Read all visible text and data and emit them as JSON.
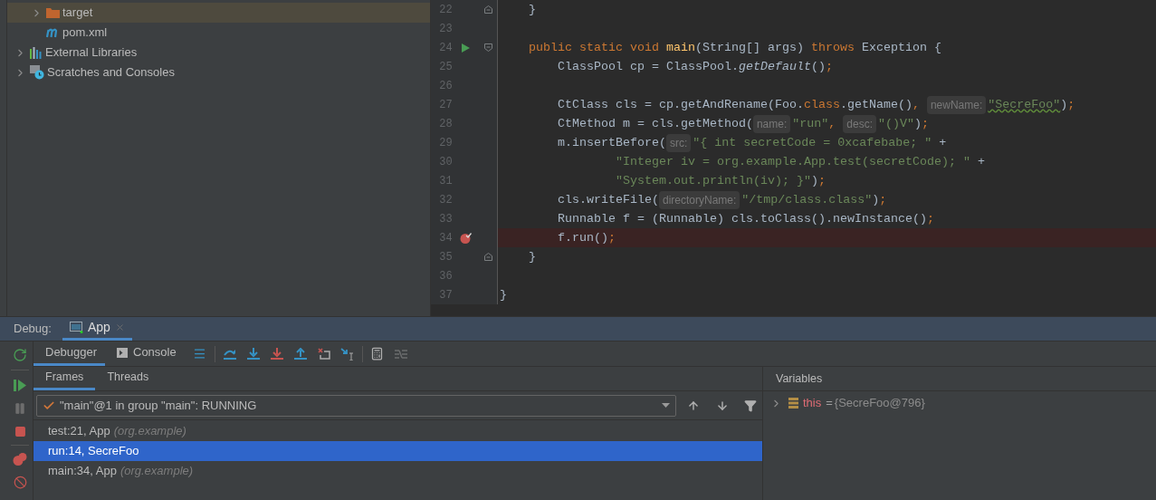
{
  "project_tree": [
    {
      "kind": "folder",
      "label": "target",
      "expanded": false,
      "selected": true
    },
    {
      "kind": "maven-file",
      "label": "pom.xml",
      "selected": false
    },
    {
      "kind": "libraries",
      "label": "External Libraries",
      "expanded": false,
      "selected": false
    },
    {
      "kind": "scratches",
      "label": "Scratches and Consoles",
      "expanded": false,
      "selected": false
    }
  ],
  "editor": {
    "lines": [
      {
        "number": "22",
        "runnable": false,
        "breakpoint": false,
        "fold_start": false,
        "fold_end": true,
        "highlighted": false,
        "tokens": [
          {
            "kind": "plain",
            "text": "    }"
          }
        ]
      },
      {
        "number": "23",
        "runnable": false,
        "breakpoint": false,
        "fold_start": false,
        "fold_end": false,
        "highlighted": false
      },
      {
        "number": "24",
        "runnable": true,
        "breakpoint": false,
        "fold_start": true,
        "fold_end": false,
        "highlighted": false,
        "tokens": [
          {
            "kind": "keyword",
            "text": "    public static void "
          },
          {
            "kind": "declaration",
            "text": "main"
          },
          {
            "kind": "plain",
            "text": "(String[] args) "
          },
          {
            "kind": "keyword",
            "text": "throws"
          },
          {
            "kind": "plain",
            "text": " Exception {"
          }
        ]
      },
      {
        "number": "25",
        "runnable": false,
        "breakpoint": false,
        "fold_start": false,
        "fold_end": false,
        "highlighted": false,
        "tokens": [
          {
            "kind": "plain",
            "text": "        ClassPool cp = ClassPool."
          },
          {
            "kind": "italic",
            "text": "getDefault"
          },
          {
            "kind": "plain",
            "text": "()"
          },
          {
            "kind": "keyword",
            "text": ";"
          }
        ]
      },
      {
        "number": "26",
        "runnable": false,
        "breakpoint": false,
        "fold_start": false,
        "fold_end": false,
        "highlighted": false
      },
      {
        "number": "27",
        "runnable": false,
        "breakpoint": false,
        "fold_start": false,
        "fold_end": false,
        "highlighted": false,
        "tokens": [
          {
            "kind": "plain",
            "text": "        CtClass cls = cp.getAndRename(Foo."
          },
          {
            "kind": "keyword",
            "text": "class"
          },
          {
            "kind": "plain",
            "text": ".getName()"
          },
          {
            "kind": "keyword",
            "text": ", "
          },
          {
            "kind": "hint",
            "text": "newName:"
          },
          {
            "kind": "typo-string",
            "text": "\"SecreFoo\""
          },
          {
            "kind": "plain",
            "text": ")"
          },
          {
            "kind": "keyword",
            "text": ";"
          }
        ]
      },
      {
        "number": "28",
        "runnable": false,
        "breakpoint": false,
        "fold_start": false,
        "fold_end": false,
        "highlighted": false,
        "tokens": [
          {
            "kind": "plain",
            "text": "        CtMethod m = cls.getMethod("
          },
          {
            "kind": "hint",
            "text": "name:"
          },
          {
            "kind": "string",
            "text": "\"run\""
          },
          {
            "kind": "keyword",
            "text": ", "
          },
          {
            "kind": "hint",
            "text": "desc:"
          },
          {
            "kind": "string",
            "text": "\"()V\""
          },
          {
            "kind": "plain",
            "text": ")"
          },
          {
            "kind": "keyword",
            "text": ";"
          }
        ]
      },
      {
        "number": "29",
        "runnable": false,
        "breakpoint": false,
        "fold_start": false,
        "fold_end": false,
        "highlighted": false,
        "tokens": [
          {
            "kind": "plain",
            "text": "        m.insertBefore("
          },
          {
            "kind": "hint",
            "text": "src:"
          },
          {
            "kind": "string",
            "text": "\"{ int secretCode = 0xcafebabe; \""
          },
          {
            "kind": "plain",
            "text": " +"
          }
        ]
      },
      {
        "number": "30",
        "runnable": false,
        "breakpoint": false,
        "fold_start": false,
        "fold_end": false,
        "highlighted": false,
        "tokens": [
          {
            "kind": "string",
            "text": "                \"Integer iv = org.example.App.test(secretCode); \""
          },
          {
            "kind": "plain",
            "text": " +"
          }
        ]
      },
      {
        "number": "31",
        "runnable": false,
        "breakpoint": false,
        "fold_start": false,
        "fold_end": false,
        "highlighted": false,
        "tokens": [
          {
            "kind": "string",
            "text": "                \"System.out.println(iv); }\""
          },
          {
            "kind": "plain",
            "text": ")"
          },
          {
            "kind": "keyword",
            "text": ";"
          }
        ]
      },
      {
        "number": "32",
        "runnable": false,
        "breakpoint": false,
        "fold_start": false,
        "fold_end": false,
        "highlighted": false,
        "tokens": [
          {
            "kind": "plain",
            "text": "        cls.writeFile("
          },
          {
            "kind": "hint",
            "text": "directoryName:"
          },
          {
            "kind": "string",
            "text": "\"/tmp/class.class\""
          },
          {
            "kind": "plain",
            "text": ")"
          },
          {
            "kind": "keyword",
            "text": ";"
          }
        ]
      },
      {
        "number": "33",
        "runnable": false,
        "breakpoint": false,
        "fold_start": false,
        "fold_end": false,
        "highlighted": false,
        "tokens": [
          {
            "kind": "plain",
            "text": "        Runnable f = (Runnable) cls.toClass().newInstance()"
          },
          {
            "kind": "keyword",
            "text": ";"
          }
        ]
      },
      {
        "number": "34",
        "runnable": false,
        "breakpoint": true,
        "fold_start": false,
        "fold_end": false,
        "highlighted": true,
        "tokens": [
          {
            "kind": "plain",
            "text": "        f.run()"
          },
          {
            "kind": "keyword",
            "text": ";"
          }
        ]
      },
      {
        "number": "35",
        "runnable": false,
        "breakpoint": false,
        "fold_start": false,
        "fold_end": true,
        "highlighted": false,
        "tokens": [
          {
            "kind": "plain",
            "text": "    }"
          }
        ]
      },
      {
        "number": "36",
        "runnable": false,
        "breakpoint": false,
        "fold_start": false,
        "fold_end": false,
        "highlighted": false
      },
      {
        "number": "37",
        "runnable": false,
        "breakpoint": false,
        "fold_start": false,
        "fold_end": false,
        "highlighted": false,
        "tokens": [
          {
            "kind": "plain",
            "text": "}"
          }
        ]
      }
    ]
  },
  "debug": {
    "title": "Debug:",
    "tabs": [
      {
        "label": "App",
        "selected": true
      }
    ],
    "toolbar_tabs": [
      {
        "label": "Debugger",
        "selected": true
      },
      {
        "label": "Console",
        "selected": false
      }
    ],
    "frame_tabs": [
      {
        "label": "Frames",
        "selected": true
      },
      {
        "label": "Threads",
        "selected": false
      }
    ],
    "thread": "\"main\"@1 in group \"main\": RUNNING",
    "frames": [
      {
        "location": "test:21, App",
        "package": "(org.example)",
        "selected": false
      },
      {
        "location": "run:14, SecreFoo",
        "selected": true
      },
      {
        "location": "main:34, App",
        "package": "(org.example)",
        "selected": false
      }
    ],
    "variables": {
      "title": "Variables",
      "items": [
        {
          "name": "this",
          "operator": "=",
          "value": "{SecreFoo@796}",
          "expanded": false
        }
      ]
    }
  }
}
